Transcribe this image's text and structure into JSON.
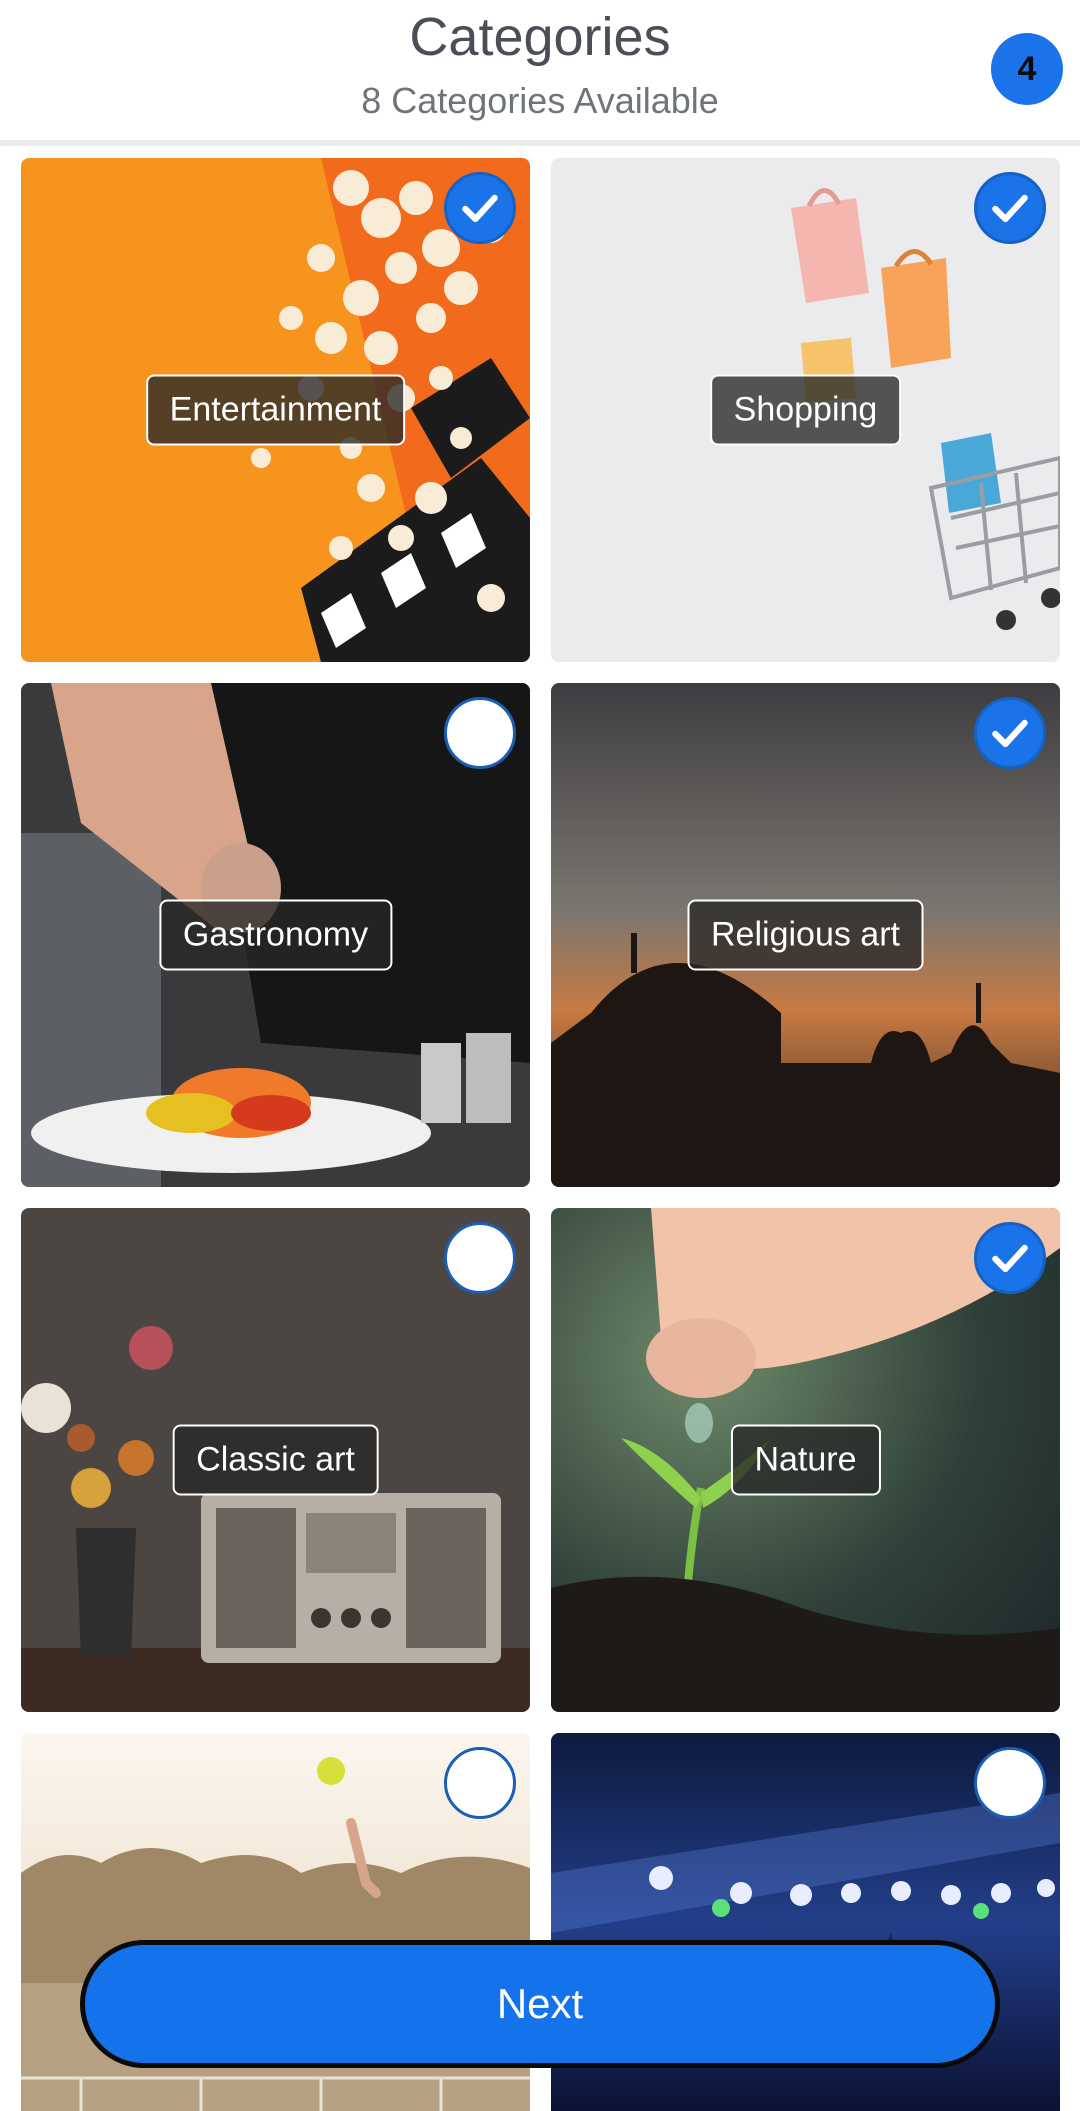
{
  "header": {
    "title": "Categories",
    "subtitle": "8 Categories Available",
    "selected_count": "4"
  },
  "categories": [
    {
      "label": "Entertainment",
      "selected": true,
      "icon": "popcorn-clapperboard-image"
    },
    {
      "label": "Shopping",
      "selected": true,
      "icon": "shopping-bags-cart-image"
    },
    {
      "label": "Gastronomy",
      "selected": false,
      "icon": "chef-plating-salmon-image"
    },
    {
      "label": "Religious art",
      "selected": true,
      "icon": "mosque-silhouette-sunset-image"
    },
    {
      "label": "Classic art",
      "selected": false,
      "icon": "vintage-radio-flowers-image"
    },
    {
      "label": "Nature",
      "selected": true,
      "icon": "seedling-water-drop-image"
    },
    {
      "label": "",
      "selected": false,
      "icon": "tennis-ball-toss-image"
    },
    {
      "label": "",
      "selected": false,
      "icon": "concert-stage-lights-image"
    }
  ],
  "footer": {
    "next_label": "Next"
  },
  "colors": {
    "accent": "#1a73e8",
    "button": "#1472eb"
  }
}
